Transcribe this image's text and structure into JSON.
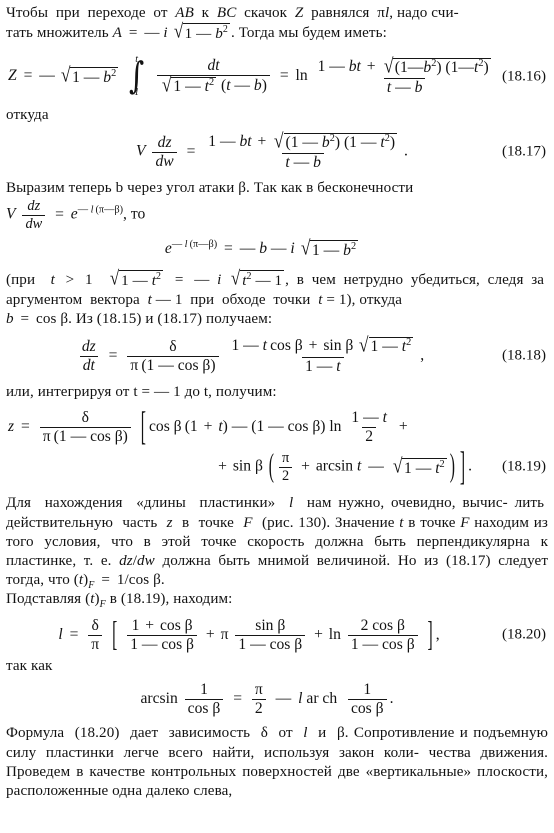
{
  "document": {
    "language": "ru",
    "type": "scanned-textbook-page",
    "figure_reference": "рис. 130"
  },
  "paragraphs": {
    "p1": {
      "line1": "Чтобы при переходе от AB к BC скачок Z равнялся πl, надо счи-",
      "line2": "тать множитель A = — i √(1 — b²). Тогда мы будем иметь:",
      "plain": "Чтобы при переходе от AB к BC скачок Z равнялся πl, надо считать множитель A = — i √(1 — b²). Тогда мы будем иметь:"
    },
    "p2": {
      "text": "откуда"
    },
    "p3": {
      "line1": "Выразим теперь b через угол атаки β. Так как в бесконечности",
      "line2_tail": ", то",
      "plain": "Выразим теперь b через угол атаки β. Так как в бесконечности V dz/dw = e^(−l(π−β)), то"
    },
    "p4": {
      "line1_tail": ", в чем нетрудно убедиться, следя",
      "line2": "за аргументом вектора t — 1 при обходе точки t = 1), откуда",
      "line3_tail": ". Из (18.15) и (18.17) получаем:",
      "plain": "(при t > 1 √(1 — t²) = — i √(t² — 1), в чем нетрудно убедиться, следя за аргументом вектора t — 1 при обходе точки t = 1), откуда b = cos β. Из (18.15) и (18.17) получаем:"
    },
    "p5": {
      "text": "или, интегрируя от t = — 1 до t, получим:"
    },
    "p6": {
      "line1": "Для нахождения «длины пластинки» l нам нужно, очевидно, вычис-",
      "line2": "лить действительную часть z в точке F (рис. 130). Значение t",
      "line3": "в точке F находим из того условия, что в этой точке скорость",
      "line4": "должна быть перпендикулярна к пластинке, т. е. dz/dw должна быть",
      "line5": "мнимой величиной. Но из (18.17) следует тогда, что (t)F = 1/cos β.",
      "line6": "Подставляя (t)F в (18.19), находим:"
    },
    "p7": {
      "text": "так как"
    },
    "p8": {
      "line1": "Формула (18.20) дает зависимость δ от l и β. Сопротивление и",
      "line2": "подъемную силу пластинки легче всего найти, используя закон коли-",
      "line3": "чества движения. Проведем в качестве контрольных поверхностей",
      "line4": "две «вертикальные» плоскости, расположенные одна далеко слева,"
    }
  },
  "equations": {
    "eq_18_16": {
      "tag": "(18.16)",
      "latex": "Z = -\\sqrt{1-b^2}\\int_{1}^{t}\\frac{dt}{\\sqrt{1-t^2}\\,(t-b)} = \\ln\\frac{1-bt+\\sqrt{(1-b^2)(1-t^2)}}{t-b}"
    },
    "eq_18_17": {
      "tag": "(18.17)",
      "latex": "V\\frac{dz}{dw} = \\frac{1-bt+\\sqrt{(1-b^2)(1-t^2)}}{t-b}."
    },
    "eq_inline_vdzdw": {
      "latex": "V\\frac{dz}{dw} = e^{-l(\\pi-\\beta)}"
    },
    "eq_exp": {
      "latex": "e^{-l(\\pi-\\beta)} = -b - i\\sqrt{1-b^2}"
    },
    "eq_inline_sqrt": {
      "latex": "(\\text{при } t>1\\ \\sqrt{1-t^2} = -i\\sqrt{t^2-1}"
    },
    "eq_inline_bcos": {
      "latex": "b = \\cos\\beta"
    },
    "eq_18_18": {
      "tag": "(18.18)",
      "latex": "\\frac{dz}{dt} = \\frac{\\delta}{\\pi(1-\\cos\\beta)}\\,\\frac{1-t\\cos\\beta+\\sin\\beta\\sqrt{1-t^2}}{1-t},"
    },
    "eq_18_19": {
      "tag": "(18.19)",
      "latex": "z = \\frac{\\delta}{\\pi(1-\\cos\\beta)}\\left[\\cos\\beta(1+t)-(1-\\cos\\beta)\\ln\\frac{1-t}{2}+\\sin\\beta\\left(\\frac{\\pi}{2}+\\arcsin t-\\sqrt{1-t^2}\\right)\\right]."
    },
    "eq_18_20": {
      "tag": "(18.20)",
      "latex": "l = \\frac{\\delta}{\\pi}\\left[\\frac{1+\\cos\\beta}{1-\\cos\\beta}+\\pi\\frac{\\sin\\beta}{1-\\cos\\beta}+\\ln\\frac{2\\cos\\beta}{1-\\cos\\beta}\\right],"
    },
    "eq_arcsin": {
      "latex": "\\arcsin\\frac{1}{\\cos\\beta} = \\frac{\\pi}{2} - l\\,\\mathrm{ar\\,ch}\\frac{1}{\\cos\\beta}."
    }
  },
  "symbols": {
    "Z": "Z",
    "A": "A",
    "b": "b",
    "t": "t",
    "l": "l",
    "z": "z",
    "w": "w",
    "V": "V",
    "F": "F",
    "i": "i",
    "beta": "β",
    "pi": "π",
    "delta": "δ",
    "AB": "AB",
    "BC": "BC",
    "cos": "cos",
    "sin": "sin",
    "ln": "ln",
    "arcsin": "arcsin",
    "arch": "ar ch",
    "dz": "dz",
    "dt": "dt",
    "dw": "dw",
    "minus": "—",
    "plus": "+",
    "equals": "=",
    "gt": ">",
    "one": "1",
    "two": "2",
    "sq": "2",
    "e": "e",
    "ref_18_15": "(18.15)",
    "ref_18_17": "(18.17)",
    "ref_18_19": "(18.19)",
    "ref_18_20": "(18.20)",
    "fig_130": "(рис. 130)"
  },
  "colors": {
    "ink": "#121212",
    "page": "#ffffff"
  }
}
